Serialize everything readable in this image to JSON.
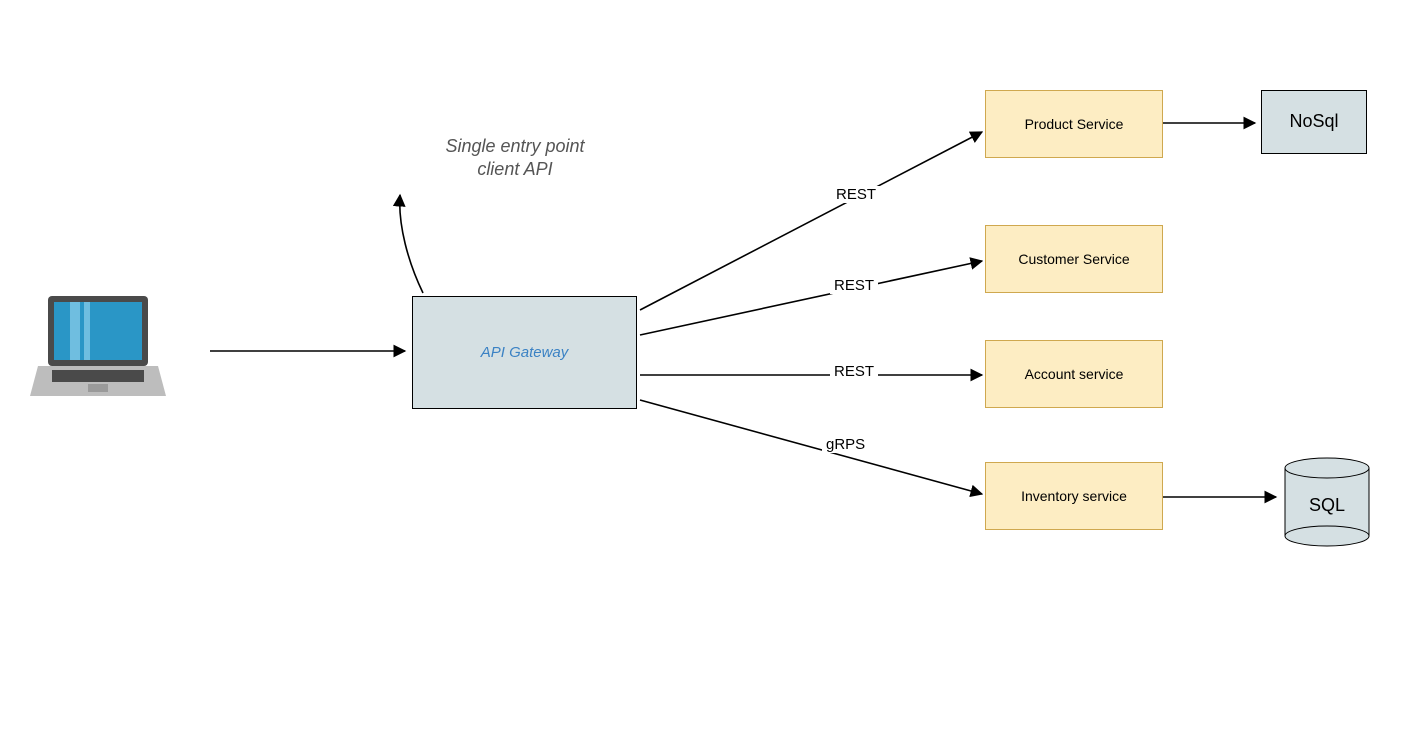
{
  "annotation": {
    "line1": "Single entry point",
    "line2": "client API"
  },
  "nodes": {
    "gateway": "API Gateway",
    "product": "Product Service",
    "customer": "Customer Service",
    "account": "Account service",
    "inventory": "Inventory service",
    "nosql": "NoSql",
    "sql": "SQL"
  },
  "edges": {
    "rest1": "REST",
    "rest2": "REST",
    "rest3": "REST",
    "grps": "gRPS"
  }
}
